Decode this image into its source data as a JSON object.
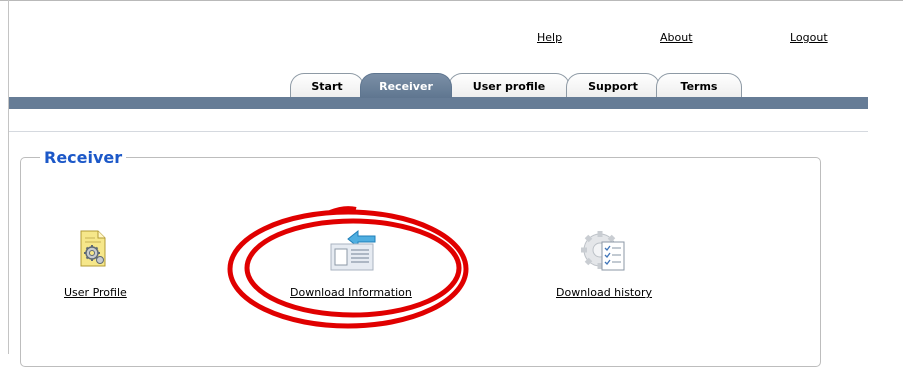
{
  "top_links": {
    "help": "Help",
    "about": "About",
    "logout": "Logout"
  },
  "tabs": [
    {
      "label": "Start",
      "active": false
    },
    {
      "label": "Receiver",
      "active": true
    },
    {
      "label": "User profile",
      "active": false
    },
    {
      "label": "Support",
      "active": false
    },
    {
      "label": "Terms",
      "active": false
    }
  ],
  "panel": {
    "title": "Receiver",
    "items": [
      {
        "label": "User Profile",
        "icon": "user-profile-document-gear-icon"
      },
      {
        "label": "Download Information",
        "icon": "download-information-icon"
      },
      {
        "label": "Download history",
        "icon": "download-history-gear-icon"
      }
    ]
  },
  "colors": {
    "band": "#667c96",
    "active_tab": "#6b8098",
    "panel_title": "#1c58c8",
    "annotation": "#e00000"
  }
}
